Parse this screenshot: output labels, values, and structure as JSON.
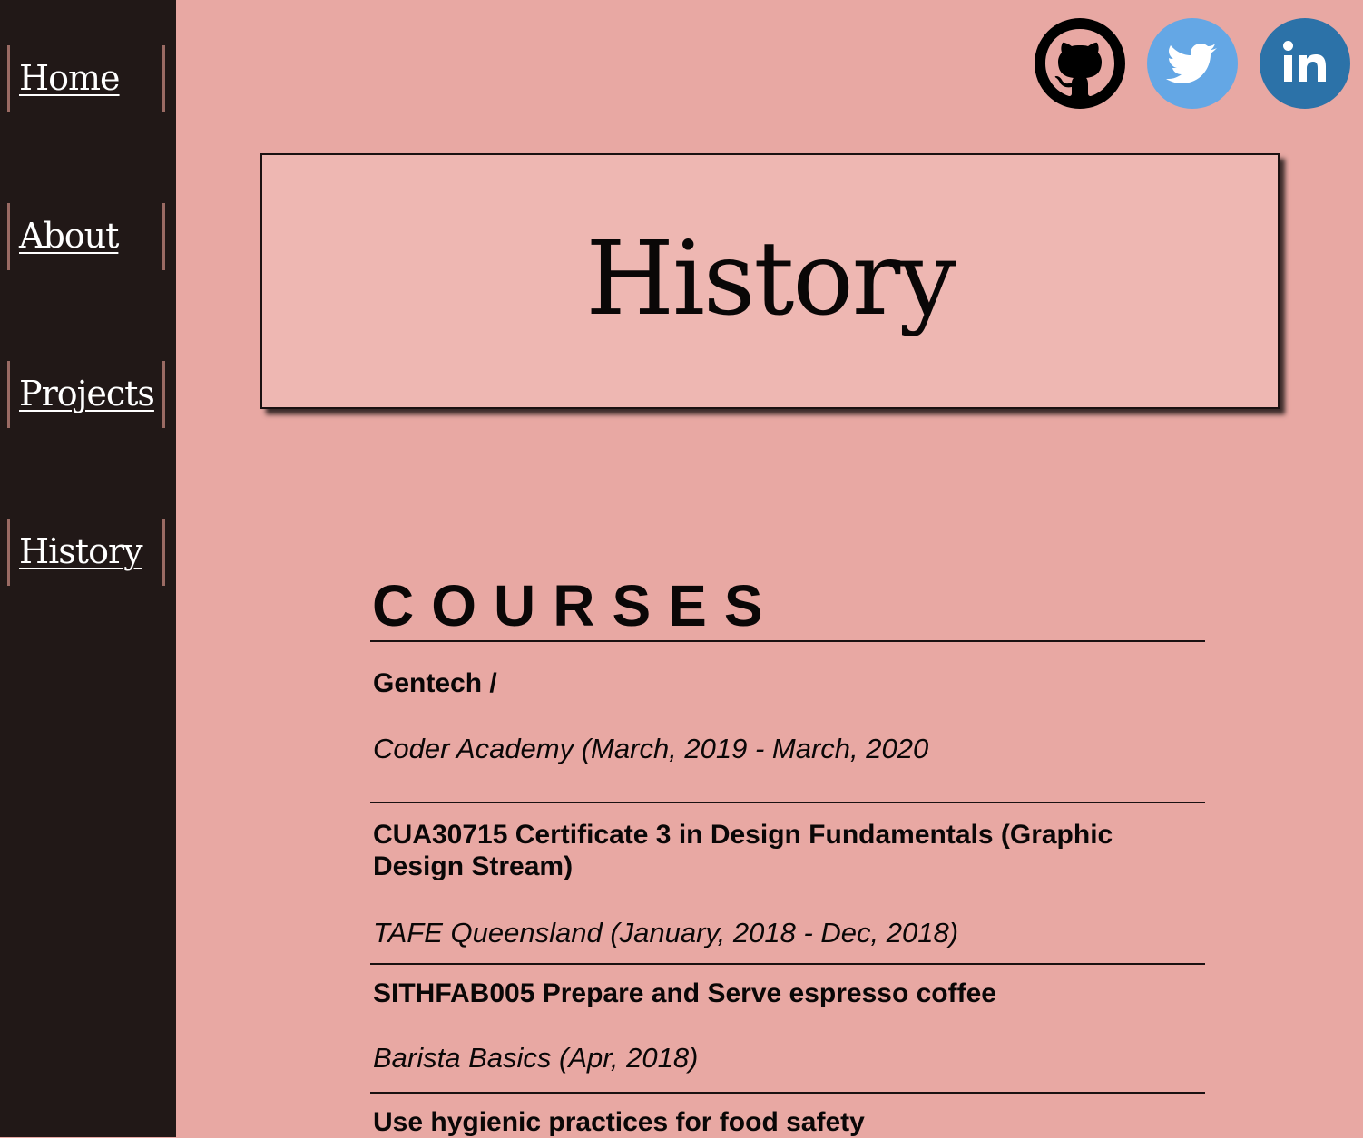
{
  "nav": {
    "items": [
      {
        "label": "Home"
      },
      {
        "label": "About"
      },
      {
        "label": "Projects"
      },
      {
        "label": "History"
      }
    ]
  },
  "social": {
    "links": [
      {
        "icon": "github-icon",
        "color": "#000000"
      },
      {
        "icon": "twitter-icon",
        "color": "#64a7e5"
      },
      {
        "icon": "linkedin-icon",
        "color": "#2c72a8"
      }
    ]
  },
  "header": {
    "title": "History"
  },
  "courses": {
    "heading": "COURSES",
    "entries": [
      {
        "title": "Gentech /",
        "sub": "Coder Academy (March, 2019 - March, 2020"
      },
      {
        "title": "CUA30715 Certificate 3 in Design Fundamentals (Graphic Design Stream)",
        "sub": "TAFE Queensland (January, 2018 - Dec, 2018)"
      },
      {
        "title": "SITHFAB005 Prepare and Serve espresso coffee",
        "sub": "Barista Basics (Apr, 2018)"
      },
      {
        "title": "Use hygienic practices for food safety",
        "sub": ""
      }
    ]
  },
  "colors": {
    "page_bg": "#e8a8a3",
    "sidebar_bg": "#211817",
    "hero_bg": "#eeb7b2",
    "nav_border": "#9a6a63"
  }
}
